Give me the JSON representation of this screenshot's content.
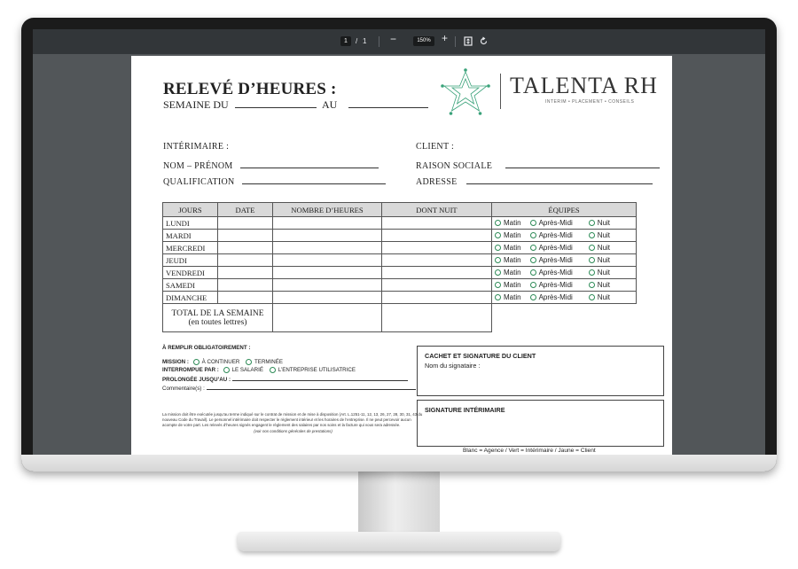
{
  "viewer": {
    "current_page": "1",
    "page_separator": "/",
    "total_pages": "1",
    "zoom_out_icon": "minus-icon",
    "zoom_level": "150%",
    "zoom_in_icon": "plus-icon",
    "fit_icon": "fit-page-icon",
    "rotate_icon": "rotate-icon"
  },
  "form": {
    "title": "RELEVÉ D’HEURES :",
    "semaine_label": "SEMAINE DU",
    "au_label": "AU",
    "interimaire_label": "INTÉRIMAIRE :",
    "nom_label": "NOM – PRÉNOM",
    "qualification_label": "QUALIFICATION",
    "client_label": "CLIENT :",
    "raison_label": "RAISON SOCIALE",
    "adresse_label": "ADRESSE"
  },
  "logo": {
    "name": "TALENTA RH",
    "tagline": "INTERIM • PLACEMENT • CONSEILS",
    "colors": {
      "green": "#3aa27a",
      "gray": "#555555"
    }
  },
  "table": {
    "headers": [
      "JOURS",
      "DATE",
      "NOMBRE D’HEURES",
      "DONT NUIT",
      "ÉQUIPES"
    ],
    "days": [
      "LUNDI",
      "MARDI",
      "MERCREDI",
      "JEUDI",
      "VENDREDI",
      "SAMEDI",
      "DIMANCHE"
    ],
    "shifts": [
      "Matin",
      "Après-Midi",
      "Nuit"
    ],
    "total_label": "TOTAL DE LA SEMAINE",
    "total_sub": "(en toutes lettres)"
  },
  "mandatory": {
    "title": "À REMPLIR OBLIGATOIREMENT :",
    "mission_label": "MISSION :",
    "mission_opt1": "À CONTINUER",
    "mission_opt2": "TERMINÉE",
    "interrupt_label": "INTERROMPUE PAR :",
    "interrupt_opt1": "LE SALARIÉ",
    "interrupt_opt2": "L’ENTREPRISE UTILISATRICE",
    "prolong_label": "PROLONGÉE JUSQU’AU :",
    "comment_label": "Commentaire(s) :"
  },
  "legal": {
    "text": "La mission doit être exécutée jusqu’au terme indiqué sur le contrat de mission et de mise à disposition (Art. L.1251-11, 12, 13, 26, 27, 28, 30, 31, 43 du nouveau Code du Travail). Le personnel intérimaire doit respecter le règlement intérieur et les horaires de l’entreprise. Il ne peut percevoir aucun acompte de votre part. Les relevés d’heures signés engagent le règlement des salaires par nos soins et la facture qui vous sera adressée.",
    "note": "(voir nos conditions générales de prestations)"
  },
  "client_box": {
    "title": "CACHET ET SIGNATURE DU CLIENT",
    "subtitle": "Nom du signataire :"
  },
  "interim_box": {
    "title": "SIGNATURE INTÉRIMAIRE"
  },
  "colors_note": "Blanc = Agence / Vert = Intérimaire / Jaune = Client"
}
